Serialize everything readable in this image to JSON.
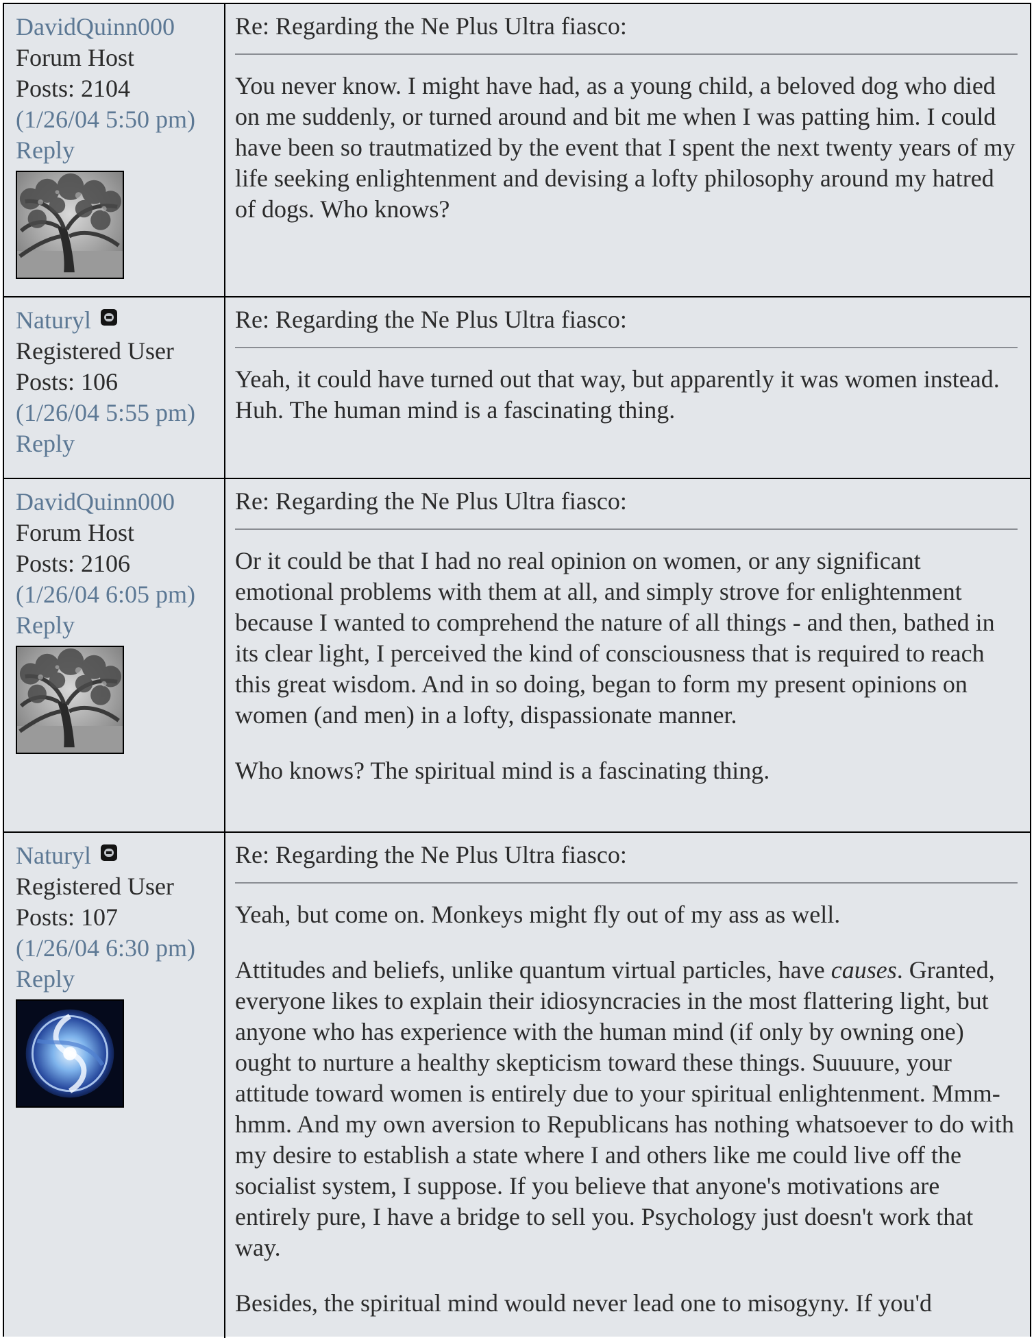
{
  "posts": [
    {
      "username": "DavidQuinn000",
      "rank": "Forum Host",
      "posts_count": "Posts: 2104",
      "timestamp": "(1/26/04 5:50 pm)",
      "reply_label": "Reply",
      "avatar": "tree-photo",
      "subject": "Re: Regarding the Ne Plus Ultra fiasco:",
      "paragraphs": [
        "You never know. I might have had, as a young child, a beloved dog who died on me suddenly, or turned around and bit me when I was patting him. I could have been so trautmatized by the event that I spent the next twenty years of my life seeking enlightenment and devising a lofty philosophy around my hatred of dogs. Who knows?"
      ]
    },
    {
      "username": "Naturyl",
      "rank": "Registered User",
      "posts_count": "Posts: 106",
      "timestamp": "(1/26/04 5:55 pm)",
      "reply_label": "Reply",
      "badge_icon": "alien-face-icon",
      "subject": "Re: Regarding the Ne Plus Ultra fiasco:",
      "paragraphs": [
        "Yeah, it could have turned out that way, but apparently it was women instead. Huh. The human mind is a fascinating thing."
      ]
    },
    {
      "username": "DavidQuinn000",
      "rank": "Forum Host",
      "posts_count": "Posts: 2106",
      "timestamp": "(1/26/04 6:05 pm)",
      "reply_label": "Reply",
      "avatar": "tree-photo",
      "subject": "Re: Regarding the Ne Plus Ultra fiasco:",
      "paragraphs": [
        "Or it could be that I had no real opinion on women, or any significant emotional problems with them at all, and simply strove for enlightenment because I wanted to comprehend the nature of all things - and then, bathed in its clear light, I perceived the kind of consciousness that is required to reach this great wisdom. And in so doing, began to form my present opinions on women (and men) in a lofty, dispassionate manner.",
        "Who knows? The spiritual mind is a fascinating thing."
      ]
    },
    {
      "username": "Naturyl",
      "rank": "Registered User",
      "posts_count": "Posts: 107",
      "timestamp": "(1/26/04 6:30 pm)",
      "reply_label": "Reply",
      "badge_icon": "alien-face-icon",
      "avatar": "glowing-orb",
      "subject": "Re: Regarding the Ne Plus Ultra fiasco:",
      "p1": "Yeah, but come on. Monkeys might fly out of my ass as well.",
      "p2_before": "Attitudes and beliefs, unlike quantum virtual particles, have ",
      "p2_em": "causes",
      "p2_after": ". Granted, everyone likes to explain their idiosyncracies in the most flattering light, but anyone who has experience with the human mind (if only by owning one) ought to nurture a healthy skepticism toward these things. Suuuure, your attitude toward women is entirely due to your spiritual enlightenment. Mmm-hmm. And my own aversion to Republicans has nothing whatsoever to do with my desire to establish a state where I and others like me could live off the socialist system, I suppose. If you believe that anyone's motivations are entirely pure, I have a bridge to sell you. Psychology just doesn't work that way.",
      "p3": "Besides, the spiritual mind would never lead one to misogyny. If you'd"
    }
  ],
  "colors": {
    "background": "#e3e6ea",
    "link": "#5c7894",
    "text": "#2b2b2b",
    "border": "#000000"
  }
}
